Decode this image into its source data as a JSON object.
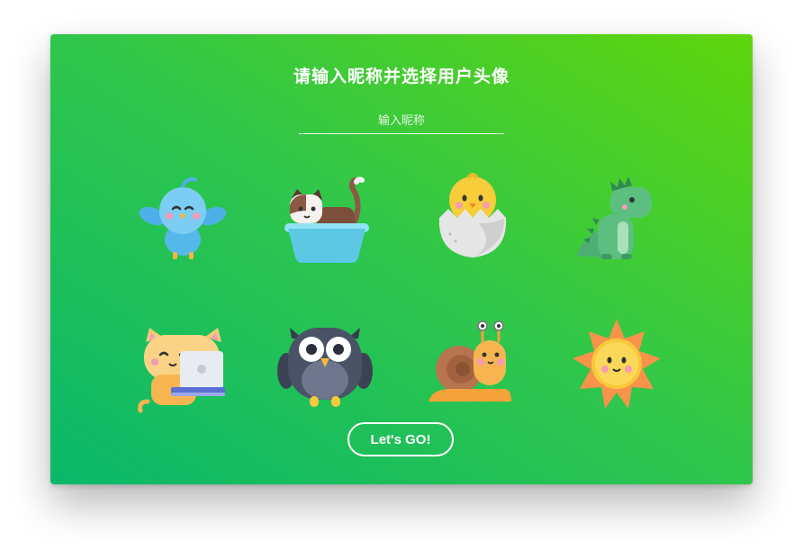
{
  "dialog": {
    "title": "请输入昵称并选择用户头像",
    "nickname_placeholder": "输入昵称",
    "nickname_value": "",
    "submit_label": "Let's GO!"
  },
  "avatars": [
    {
      "icon": "bird-icon"
    },
    {
      "icon": "cat-in-bathtub-icon"
    },
    {
      "icon": "hatching-chick-icon"
    },
    {
      "icon": "dinosaur-icon"
    },
    {
      "icon": "cat-with-laptop-icon"
    },
    {
      "icon": "owl-icon"
    },
    {
      "icon": "snail-icon"
    },
    {
      "icon": "sun-icon"
    }
  ],
  "colors": {
    "gradient_start": "#0ab86a",
    "gradient_end": "#5fd60c",
    "text": "#ffffff"
  }
}
